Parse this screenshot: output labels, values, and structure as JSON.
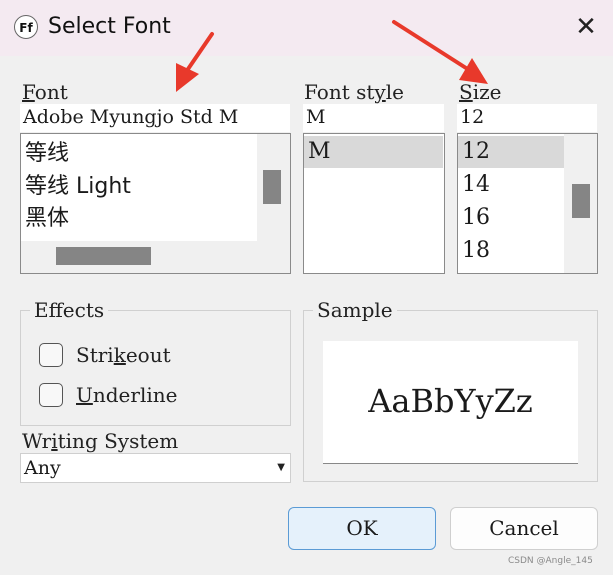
{
  "window": {
    "icon_label": "Ff",
    "title": "Select Font",
    "close": "✕"
  },
  "font": {
    "label_underlined": "F",
    "label_rest": "ont",
    "value": "Adobe Myungjo Std M",
    "items": [
      "等线",
      "等线 Light",
      "黑体"
    ]
  },
  "style": {
    "label_pre": "Font st",
    "label_underlined": "y",
    "label_post": "le",
    "value": "M",
    "items": [
      "M"
    ],
    "selected": "M"
  },
  "size": {
    "label_underlined": "S",
    "label_rest": "ize",
    "value": "12",
    "items": [
      "12",
      "14",
      "16",
      "18"
    ],
    "selected": "12"
  },
  "effects": {
    "title": "Effects",
    "strikeout_pre": "Stri",
    "strikeout_underlined": "k",
    "strikeout_post": "eout",
    "underline_underlined": "U",
    "underline_rest": "nderline",
    "strikeout_checked": false,
    "underline_checked": false
  },
  "sample": {
    "title": "Sample",
    "text": "AaBbYyZz"
  },
  "writing_system": {
    "label_pre": "Wr",
    "label_underlined": "i",
    "label_post": "ting System",
    "value": "Any",
    "arrow": "▼"
  },
  "buttons": {
    "ok": "OK",
    "cancel": "Cancel"
  },
  "watermark": "CSDN @Angle_145",
  "colors": {
    "annotation_arrow": "#e8392b",
    "titlebar": "#f4eaf1",
    "selection": "#d9d9d9",
    "ok_border": "#5b9bd5"
  }
}
